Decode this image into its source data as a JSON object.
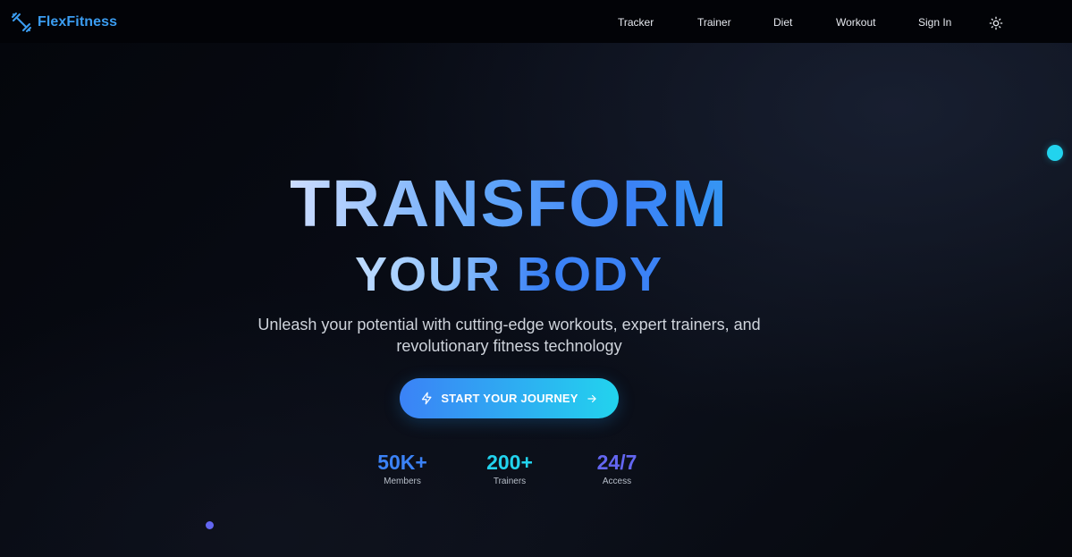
{
  "brand": {
    "name": "FlexFitness",
    "icon": "dumbbell-icon",
    "color": "#3b9df1"
  },
  "nav": {
    "items": [
      {
        "label": "Tracker"
      },
      {
        "label": "Trainer"
      },
      {
        "label": "Diet"
      },
      {
        "label": "Workout"
      },
      {
        "label": "Sign In"
      }
    ],
    "theme_icon": "sun-icon"
  },
  "hero": {
    "title_line1": "TRANSFORM",
    "title_line2": "YOUR BODY",
    "subtitle_line1": "Unleash your potential with cutting-edge workouts, expert trainers, and",
    "subtitle_line2": "revolutionary fitness technology",
    "cta_label": "START YOUR JOURNEY",
    "cta_icon": "lightning-icon",
    "cta_arrow_icon": "arrow-right-icon"
  },
  "stats": [
    {
      "value": "50K+",
      "label": "Members",
      "color": "#3b82f6"
    },
    {
      "value": "200+",
      "label": "Trainers",
      "color": "#22d3ee"
    },
    {
      "value": "24/7",
      "label": "Access",
      "color": "#6366f1"
    }
  ],
  "colors": {
    "accent_blue": "#3b82f6",
    "accent_cyan": "#22d3ee",
    "accent_purple": "#6366f1",
    "background": "#05070c"
  }
}
